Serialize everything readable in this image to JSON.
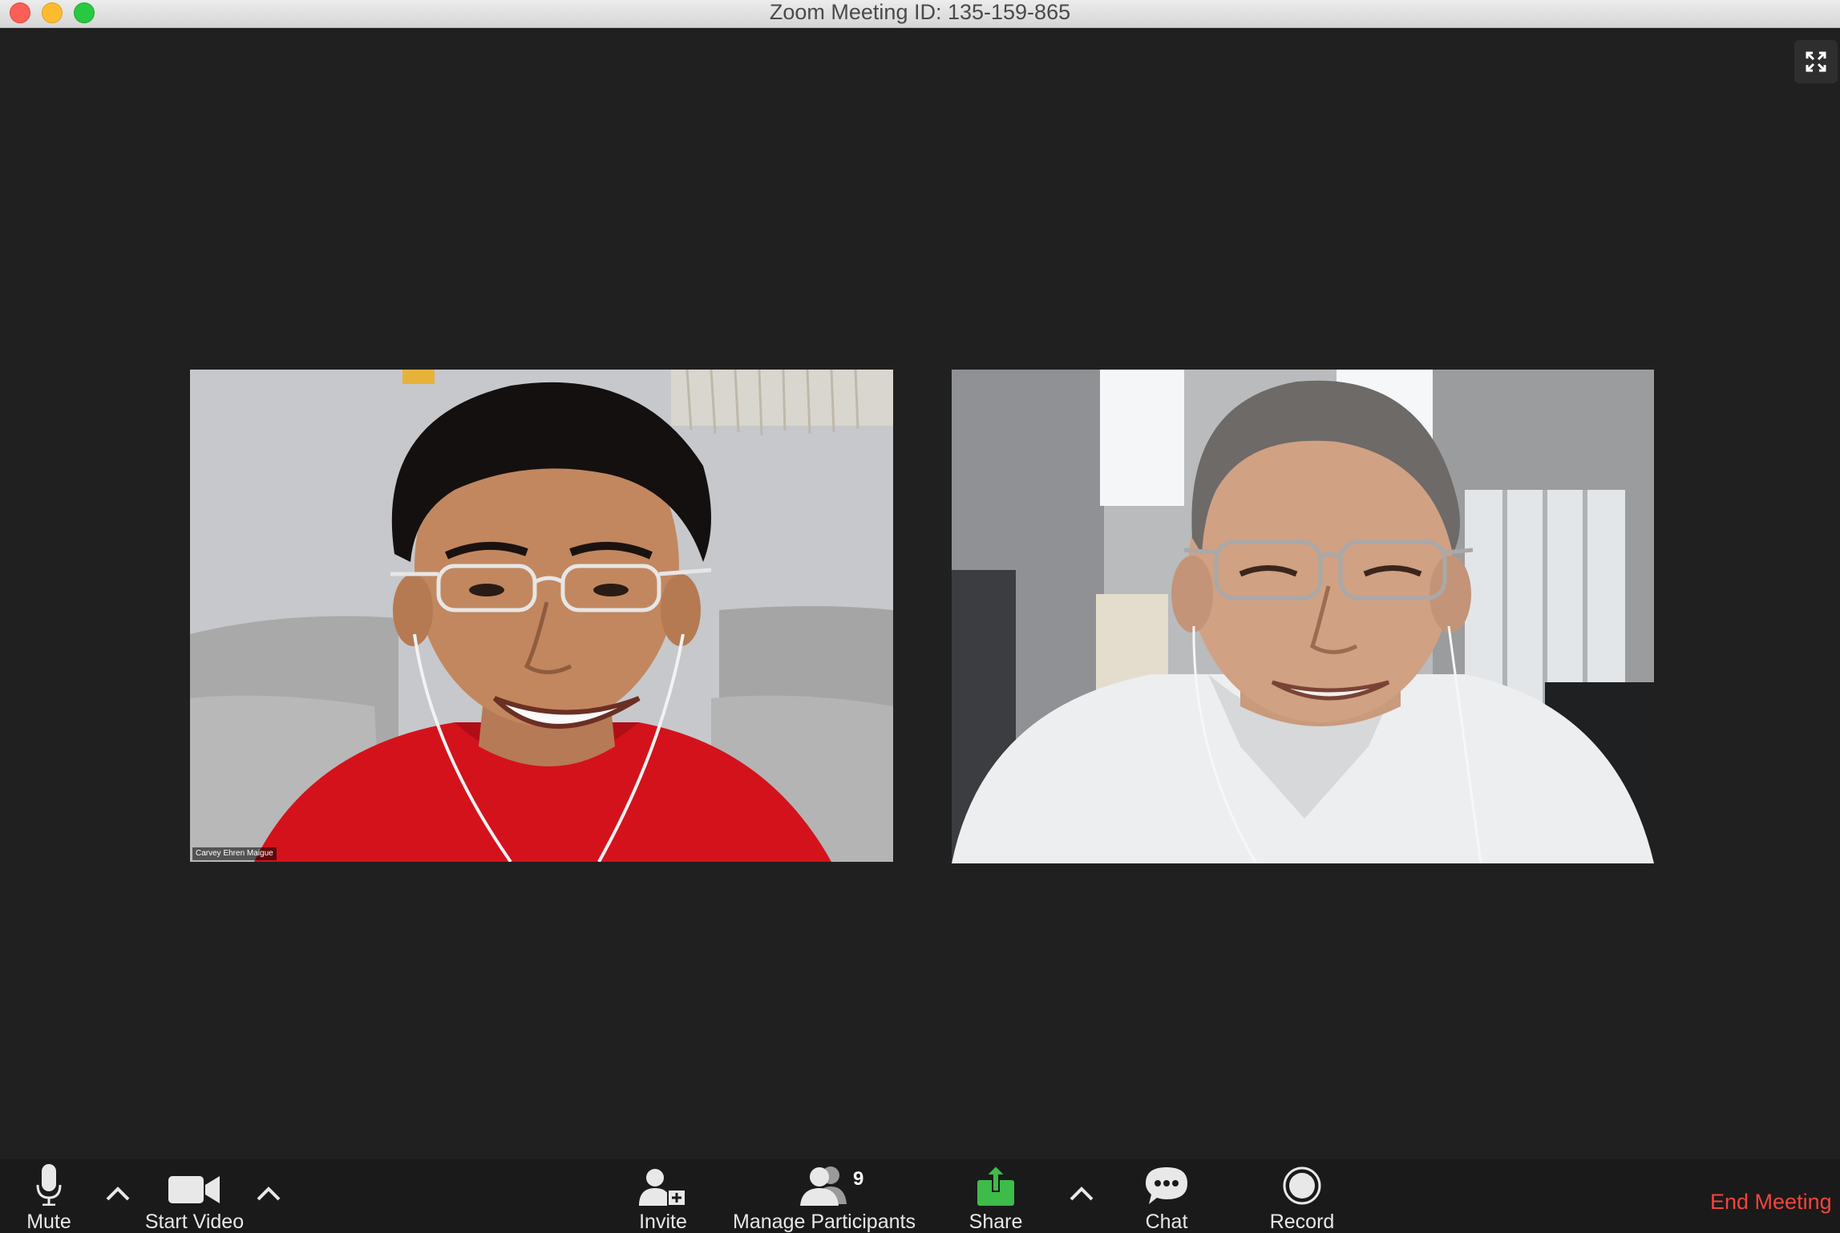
{
  "window": {
    "title": "Zoom Meeting ID: 135-159-865"
  },
  "videos": [
    {
      "name_tag": "Carvey Ehren Maigue"
    },
    {
      "name_tag": ""
    }
  ],
  "toolbar": {
    "mute_label": "Mute",
    "start_video_label": "Start Video",
    "invite_label": "Invite",
    "manage_participants_label": "Manage Participants",
    "participant_count": "9",
    "share_label": "Share",
    "chat_label": "Chat",
    "record_label": "Record",
    "end_meeting_label": "End Meeting"
  },
  "colors": {
    "background": "#202020",
    "toolbar": "#1a1a1a",
    "share_green": "#3dbc4a",
    "end_meeting_red": "#f2453d"
  },
  "icons": [
    "microphone-icon",
    "video-camera-icon",
    "invite-user-icon",
    "participants-icon",
    "share-screen-icon",
    "chat-bubble-icon",
    "record-icon",
    "fullscreen-icon"
  ]
}
